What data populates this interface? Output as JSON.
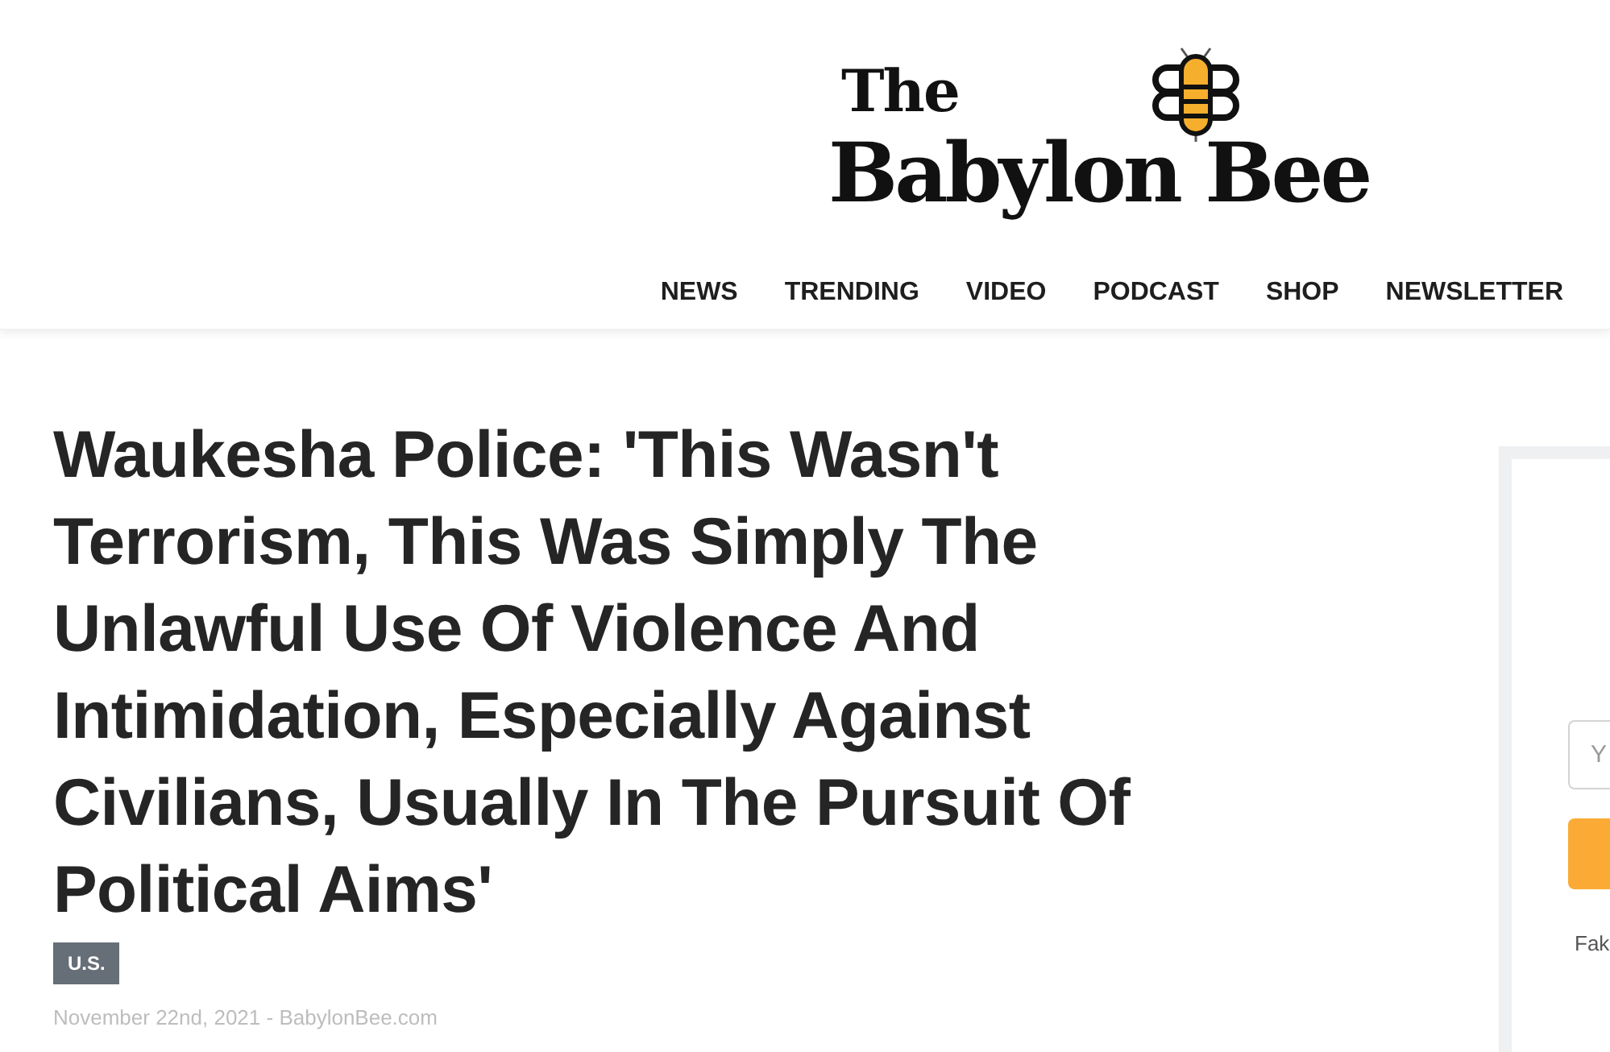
{
  "header": {
    "logo": {
      "top_line": "The",
      "main_line": "Babylon Bee"
    },
    "nav": [
      "NEWS",
      "TRENDING",
      "VIDEO",
      "PODCAST",
      "SHOP",
      "NEWSLETTER"
    ]
  },
  "article": {
    "headline": "Waukesha Police: 'This Wasn't Terrorism, This Was Simply The Unlawful Use Of Violence And Intimidation, Especially Against Civilians, Usually In The Pursuit Of Political Aims'",
    "category": "U.S.",
    "byline": "November 22nd, 2021 - BabylonBee.com"
  },
  "sidebar": {
    "email_field": {
      "placeholder": "Y"
    },
    "note": "Fak"
  }
}
